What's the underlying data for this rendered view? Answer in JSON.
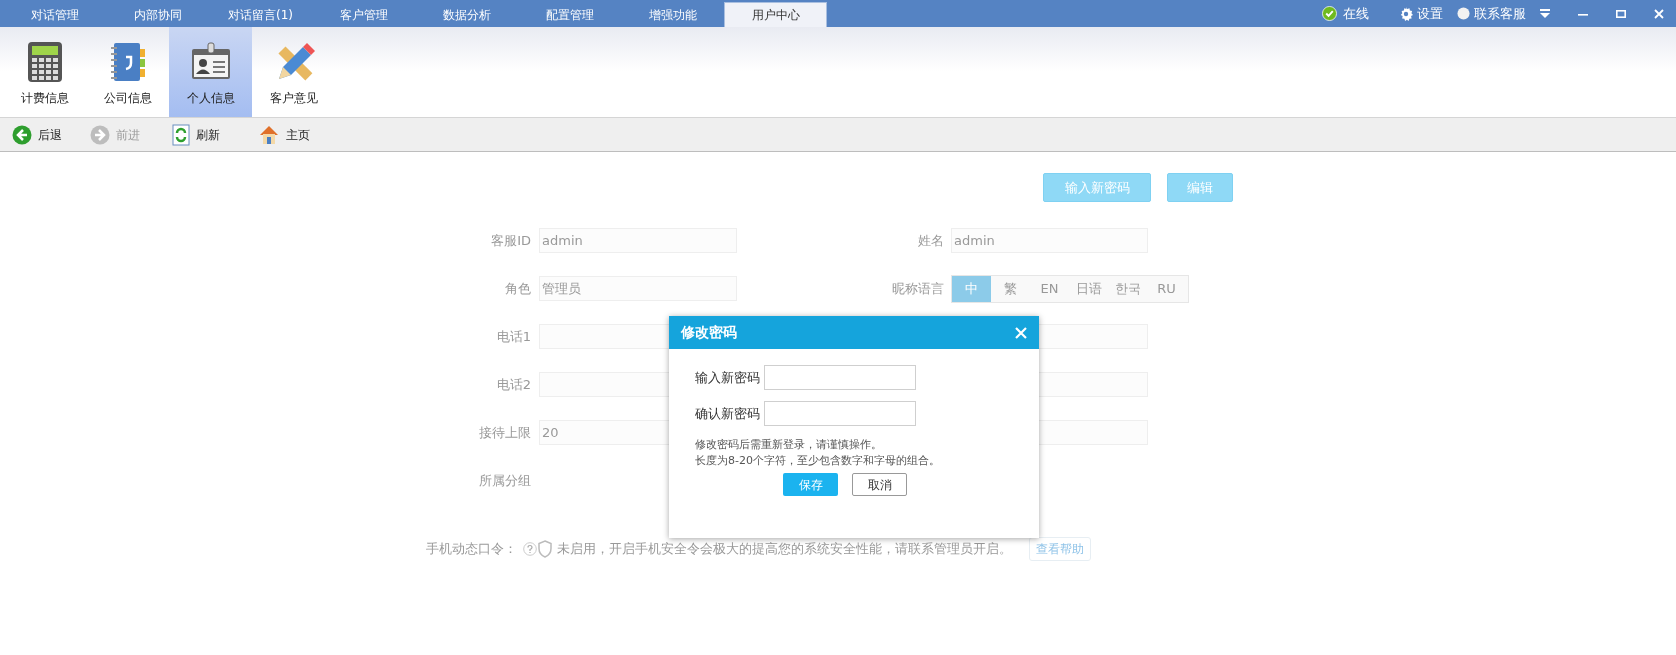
{
  "tabs": [
    {
      "label": "对话管理",
      "selected": false
    },
    {
      "label": "内部协同",
      "selected": false
    },
    {
      "label": "对话留言(1)",
      "selected": false
    },
    {
      "label": "客户管理",
      "selected": false
    },
    {
      "label": "数据分析",
      "selected": false
    },
    {
      "label": "配置管理",
      "selected": false
    },
    {
      "label": "增强功能",
      "selected": false
    },
    {
      "label": "用户中心",
      "selected": true
    }
  ],
  "status": {
    "online": "在线",
    "settings": "设置",
    "support": "联系客服"
  },
  "ribbon": [
    {
      "kind": "calculator",
      "label": "计费信息",
      "selected": false
    },
    {
      "kind": "notebook",
      "label": "公司信息",
      "selected": false
    },
    {
      "kind": "idcard",
      "label": "个人信息",
      "selected": true
    },
    {
      "kind": "pencil",
      "label": "客户意见",
      "selected": false
    }
  ],
  "toolbar": [
    {
      "kind": "back",
      "label": "后退",
      "disabled": false
    },
    {
      "kind": "forward",
      "label": "前进",
      "disabled": true
    },
    {
      "kind": "refresh",
      "label": "刷新",
      "disabled": false
    },
    {
      "kind": "home",
      "label": "主页",
      "disabled": false
    }
  ],
  "actions": [
    "输入新密码",
    "编辑"
  ],
  "form": {
    "left": [
      {
        "kind": "field",
        "label": "客服ID",
        "value": "admin"
      },
      {
        "kind": "field",
        "label": "角色",
        "value": "管理员"
      },
      {
        "kind": "field",
        "label": "电话1"
      },
      {
        "kind": "field",
        "label": "电话2"
      },
      {
        "kind": "field",
        "label": "接待上限",
        "value": "20"
      },
      {
        "kind": "plain",
        "label": "所属分组"
      }
    ],
    "right": [
      {
        "kind": "field",
        "label": "姓名",
        "value": "admin"
      },
      {
        "kind": "language",
        "label": "昵称语言",
        "options": [
          {
            "label": "中",
            "selected": true
          },
          {
            "label": "繁",
            "selected": false
          },
          {
            "label": "EN",
            "selected": false
          },
          {
            "label": "日语",
            "selected": false
          },
          {
            "label": "한국",
            "selected": false
          },
          {
            "label": "RU",
            "selected": false
          }
        ]
      },
      {
        "kind": "field"
      },
      {
        "kind": "field"
      },
      {
        "kind": "field"
      }
    ]
  },
  "security": {
    "label": "手机动态口令：",
    "text": "未启用，开启手机安全令会极大的提高您的系统安全性能，请联系管理员开启。",
    "help": "查看帮助"
  },
  "dialog": {
    "title": "修改密码",
    "fields": [
      {
        "label": "输入新密码"
      },
      {
        "label": "确认新密码"
      }
    ],
    "notes": [
      "修改密码后需重新登录，请谨慎操作。",
      "长度为8-20个字符，至少包含数字和字母的组合。"
    ],
    "buttons": [
      {
        "kind": "primary",
        "label": "保存"
      },
      {
        "kind": "secondary",
        "label": "取消"
      }
    ]
  }
}
